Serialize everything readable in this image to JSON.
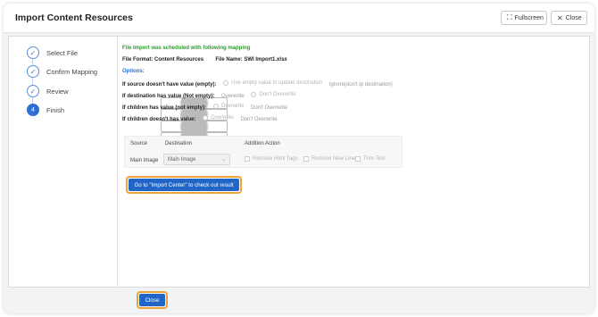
{
  "header": {
    "title": "Import Content Resources",
    "fullscreen_label": "Fullscreen",
    "close_label": "Close"
  },
  "steps": [
    {
      "label": "Select File",
      "icon": "check-icon",
      "status": "done"
    },
    {
      "label": "Confirm Mapping",
      "icon": "check-icon",
      "status": "done"
    },
    {
      "label": "Review",
      "icon": "check-icon",
      "status": "done"
    },
    {
      "label": "Finish",
      "number": "4",
      "status": "active"
    }
  ],
  "content": {
    "success_message": "File Import was scheduled with following mapping",
    "file_format_label": "File Format:",
    "file_format_value": "Content Resources",
    "file_name_label": "File Name:",
    "file_name_value": "SWI Import1.xlsx",
    "options_label": "Options:",
    "options": [
      {
        "label": "If source doesn't have value (empty):",
        "choices": [
          "Use empty value to update destination",
          "Ignore(don't ip destination)"
        ],
        "selected": 1
      },
      {
        "label": "If destination has value (Not empty):",
        "choices": [
          "Overwrite",
          "Don't Overwrite"
        ],
        "selected": 0
      },
      {
        "label": "If children has value (not empty):",
        "choices": [
          "Overwrite",
          "Don't Overwrite"
        ],
        "selected": 1
      },
      {
        "label": "If children doesn't has value:",
        "choices": [
          "Overwrite",
          "Don't Overwrite"
        ],
        "selected": 1
      }
    ]
  },
  "table": {
    "headers": [
      "Source",
      "Destination",
      "Addition Action"
    ],
    "row": {
      "source": "Main Image",
      "destination": "Main Image",
      "actions": [
        "Remove Html Tags",
        "Remove New Line",
        "Trim Text"
      ]
    }
  },
  "go_button_label": "Go to \"Import Center\" to check out result",
  "footer": {
    "close_label": "Close"
  },
  "colors": {
    "accent": "#2166c7",
    "highlight": "#f0a23a",
    "success": "#2e9a2e"
  }
}
